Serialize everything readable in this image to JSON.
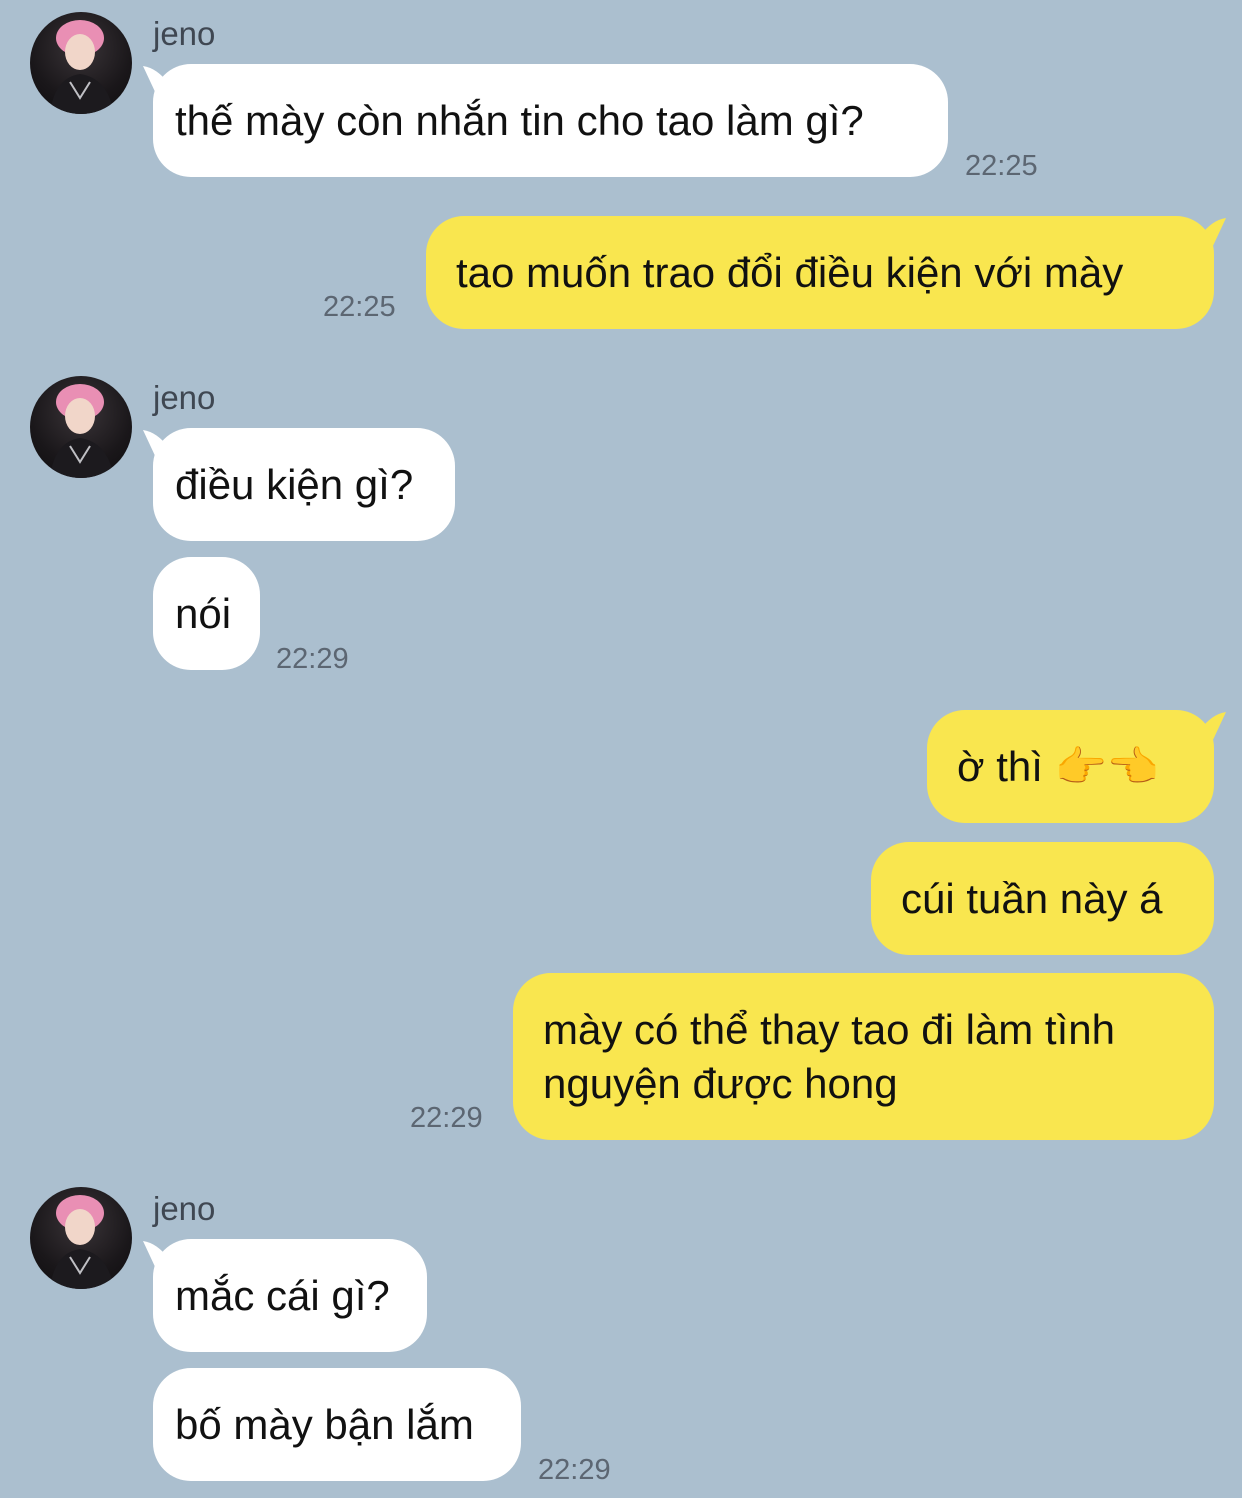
{
  "colors": {
    "background": "#abbfcf",
    "incoming_bubble": "#ffffff",
    "outgoing_bubble": "#f9e64f",
    "timestamp": "#5c6672"
  },
  "groups": [
    {
      "sender": "jeno",
      "messages": [
        {
          "text": "thế mày còn nhắn tin cho tao làm gì?"
        }
      ],
      "time": "22:25"
    },
    {
      "outgoing": true,
      "messages": [
        {
          "text": "tao muốn trao đổi điều kiện với mày"
        }
      ],
      "time": "22:25"
    },
    {
      "sender": "jeno",
      "messages": [
        {
          "text": "điều kiện gì?"
        },
        {
          "text": "nói"
        }
      ],
      "time": "22:29"
    },
    {
      "outgoing": true,
      "messages": [
        {
          "text": "ờ thì 👉👈"
        },
        {
          "text": "cúi tuần này á"
        },
        {
          "text": "mày có thể thay tao đi làm tình nguyện được hong"
        }
      ],
      "time": "22:29"
    },
    {
      "sender": "jeno",
      "messages": [
        {
          "text": "mắc cái gì?"
        },
        {
          "text": "bố mày bận lắm"
        }
      ],
      "time": "22:29"
    }
  ]
}
